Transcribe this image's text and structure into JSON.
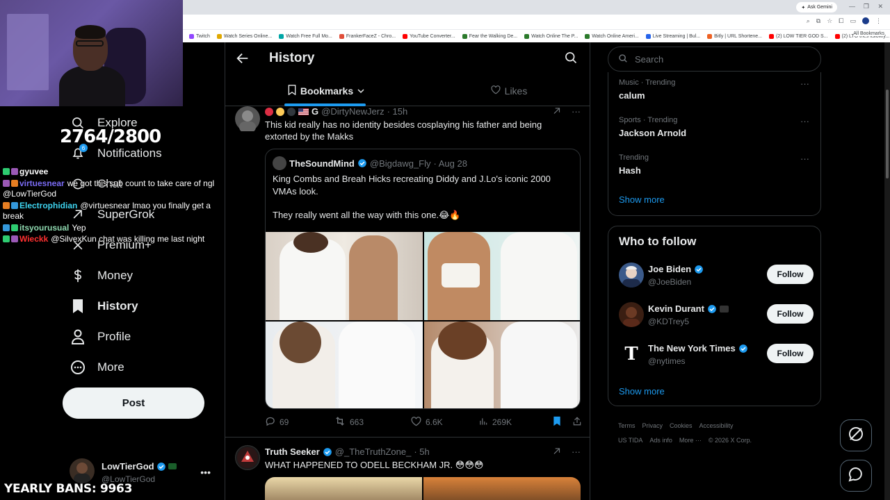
{
  "browser": {
    "gemini_label": "Ask Gemini",
    "bookmarks": [
      "Twitch",
      "Watch Series Online...",
      "Watch Free Full Mo...",
      "FrankerFaceZ - Chro...",
      "YouTube Converter...",
      "Fear the Walking De...",
      "Watch Online The P...",
      "Watch Online Ameri...",
      "Live Streaming | Bul...",
      "Bitly | URL Shortene...",
      "(2) LOW TIER GOD S...",
      "(2) LTG tries itslowly..."
    ],
    "all_bookmarks": "All Bookmarks"
  },
  "overlay": {
    "counter": "2764/2800",
    "yearly_bans": "YEARLY BANS: 9963",
    "notif_badge": "6",
    "chat": [
      {
        "user": "gyuvee",
        "user_color": "#ffffff",
        "text": ""
      },
      {
        "user": "virtuesnear",
        "user_color": "#7b6cf6",
        "text": "we got this sub count to take care of ngl @LowTierGod"
      },
      {
        "user": "Electrophidian",
        "user_color": "#3ed4f0",
        "text": "@virtuesnear lmao you finally get a break"
      },
      {
        "user": "itsyourusual",
        "user_color": "#8fd9b0",
        "text": "Yep"
      },
      {
        "user": "Wieckk",
        "user_color": "#ff3030",
        "text": "@SilvexKun chat was killing me last night"
      }
    ]
  },
  "nav": {
    "items": [
      {
        "label": "Explore",
        "icon": "search-icon"
      },
      {
        "label": "Notifications",
        "icon": "bell-icon"
      },
      {
        "label": "Chat",
        "icon": "chat-icon"
      },
      {
        "label": "SuperGrok",
        "icon": "grok-icon"
      },
      {
        "label": "Premium+",
        "icon": "x-icon"
      },
      {
        "label": "Money",
        "icon": "dollar-icon"
      },
      {
        "label": "History",
        "icon": "bookmark-icon"
      },
      {
        "label": "Profile",
        "icon": "person-icon"
      },
      {
        "label": "More",
        "icon": "more-circle-icon"
      }
    ],
    "post_label": "Post",
    "account": {
      "name": "LowTierGod",
      "handle": "@LowTierGod"
    }
  },
  "main": {
    "title": "History",
    "tabs": [
      {
        "label": "Bookmarks"
      },
      {
        "label": "Likes"
      }
    ],
    "tweet1": {
      "name": "G",
      "handle": "@DirtyNewJerz",
      "time": "· 15h",
      "text": "This kid really has no identity besides cosplaying his father and being extorted by the Makks",
      "quote": {
        "name": "TheSoundMind",
        "handle": "@Bigdawg_Fly",
        "time": "· Aug 28",
        "text_line1": "King Combs and Breah Hicks recreating Diddy and J.Lo's iconic 2000 VMAs look.",
        "text_line2": "They really went all the way with this one.😂🔥"
      },
      "replies": "69",
      "reposts": "663",
      "likes": "6.6K",
      "views": "269K"
    },
    "tweet2": {
      "name": "Truth Seeker",
      "handle": "@_TheTruthZone_",
      "time": "· 5h",
      "text": "WHAT HAPPENED TO ODELL BECKHAM JR. 😳😳😳"
    }
  },
  "right": {
    "search_placeholder": "Search",
    "trends": [
      {
        "meta": "Music · Trending",
        "topic": "calum"
      },
      {
        "meta": "Sports · Trending",
        "topic": "Jackson Arnold"
      },
      {
        "meta": "Trending",
        "topic": "Hash"
      }
    ],
    "show_more": "Show more",
    "wtf_title": "Who to follow",
    "who_to_follow": [
      {
        "name": "Joe Biden",
        "handle": "@JoeBiden"
      },
      {
        "name": "Kevin Durant",
        "handle": "@KDTrey5"
      },
      {
        "name": "The New York Times",
        "handle": "@nytimes"
      }
    ],
    "follow_label": "Follow",
    "footer": [
      "Terms",
      "Privacy",
      "Cookies",
      "Accessibility",
      "US TIDA",
      "Ads info",
      "More ···",
      "© 2026 X Corp."
    ]
  },
  "colors": {
    "accent": "#1d9bf0",
    "bg": "#000000",
    "text": "#e7e9ea",
    "muted": "#71767b"
  }
}
